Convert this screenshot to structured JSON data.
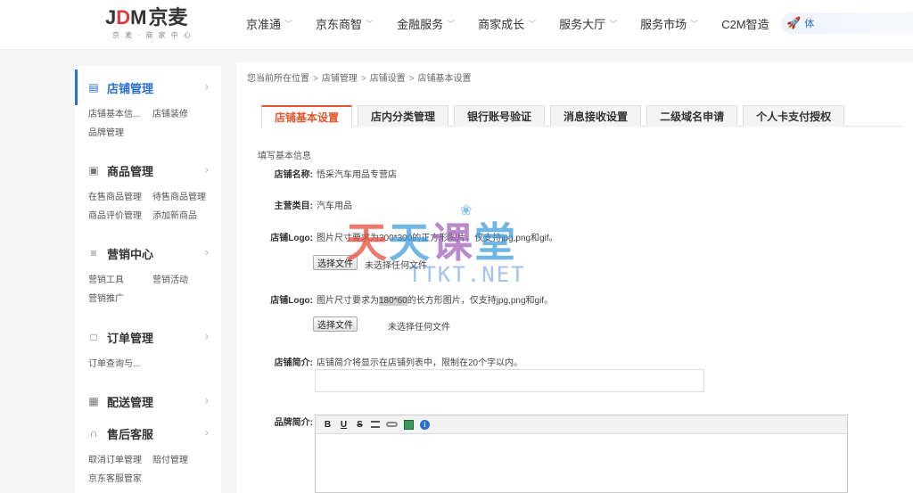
{
  "header": {
    "logo": {
      "j": "J",
      "d": "D",
      "m": "M",
      "cn": "京麦",
      "slogan": "京 麦 · 商 家 中 心"
    },
    "nav": [
      {
        "label": "京准通"
      },
      {
        "label": "京东商智"
      },
      {
        "label": "金融服务"
      },
      {
        "label": "商家成长"
      },
      {
        "label": "服务大厅"
      },
      {
        "label": "服务市场"
      },
      {
        "label": "C2M智造"
      }
    ],
    "nav_right_label": "体",
    "rocket_icon": "rocket-icon"
  },
  "sidebar": {
    "sections": [
      {
        "title": "店铺管理",
        "icon": "store-icon",
        "links": [
          "店铺基本信...",
          "店铺装修",
          "品牌管理"
        ]
      },
      {
        "title": "商品管理",
        "icon": "package-icon",
        "links": [
          "在售商品管理",
          "待售商品管理",
          "商品评价管理",
          "添加新商品"
        ]
      },
      {
        "title": "营销中心",
        "icon": "chart-icon",
        "links": [
          "营销工具",
          "营销活动",
          "营销推广"
        ]
      },
      {
        "title": "订单管理",
        "icon": "document-icon",
        "links": [
          "订单查询与..."
        ]
      },
      {
        "title": "配送管理",
        "icon": "delivery-icon",
        "links": []
      },
      {
        "title": "售后客服",
        "icon": "headset-icon",
        "links": [
          "取消订单管理",
          "赔付管理",
          "京东客服管家"
        ]
      }
    ]
  },
  "breadcrumb": [
    "您当前所在位置",
    "店铺管理",
    "店铺设置",
    "店铺基本设置"
  ],
  "tabs": [
    {
      "label": "店铺基本设置"
    },
    {
      "label": "店内分类管理"
    },
    {
      "label": "银行账号验证"
    },
    {
      "label": "消息接收设置"
    },
    {
      "label": "二级域名申请"
    },
    {
      "label": "个人卡支付授权"
    }
  ],
  "form": {
    "section_title": "填写基本信息",
    "store_name_label": "店铺名称:",
    "store_name_value": "悟采汽车用品专营店",
    "category_label": "主营类目:",
    "category_value": "汽车用品",
    "logo1_label": "店铺Logo:",
    "logo1_hint": "图片尺寸要求为300*300的正方形图片，仅支持jpg,png和gif。",
    "logo2_label": "店铺Logo:",
    "logo2_hint_pre": "图片尺寸要求为",
    "logo2_hint_hl": "180*60",
    "logo2_hint_post": "的长方形图片，仅支持jpg,png和gif。",
    "choose_file": "选择文件",
    "no_file": "未选择任何文件",
    "intro_label": "店铺简介:",
    "intro_hint": "店铺简介将显示在店铺列表中，限制在20个字以内。",
    "brand_label": "品牌简介:",
    "editor_toolbar": [
      "B",
      "U",
      "S"
    ]
  },
  "watermark": {
    "chars": [
      "天",
      "天",
      "课",
      "堂"
    ],
    "sub": "TTKT.NET"
  }
}
